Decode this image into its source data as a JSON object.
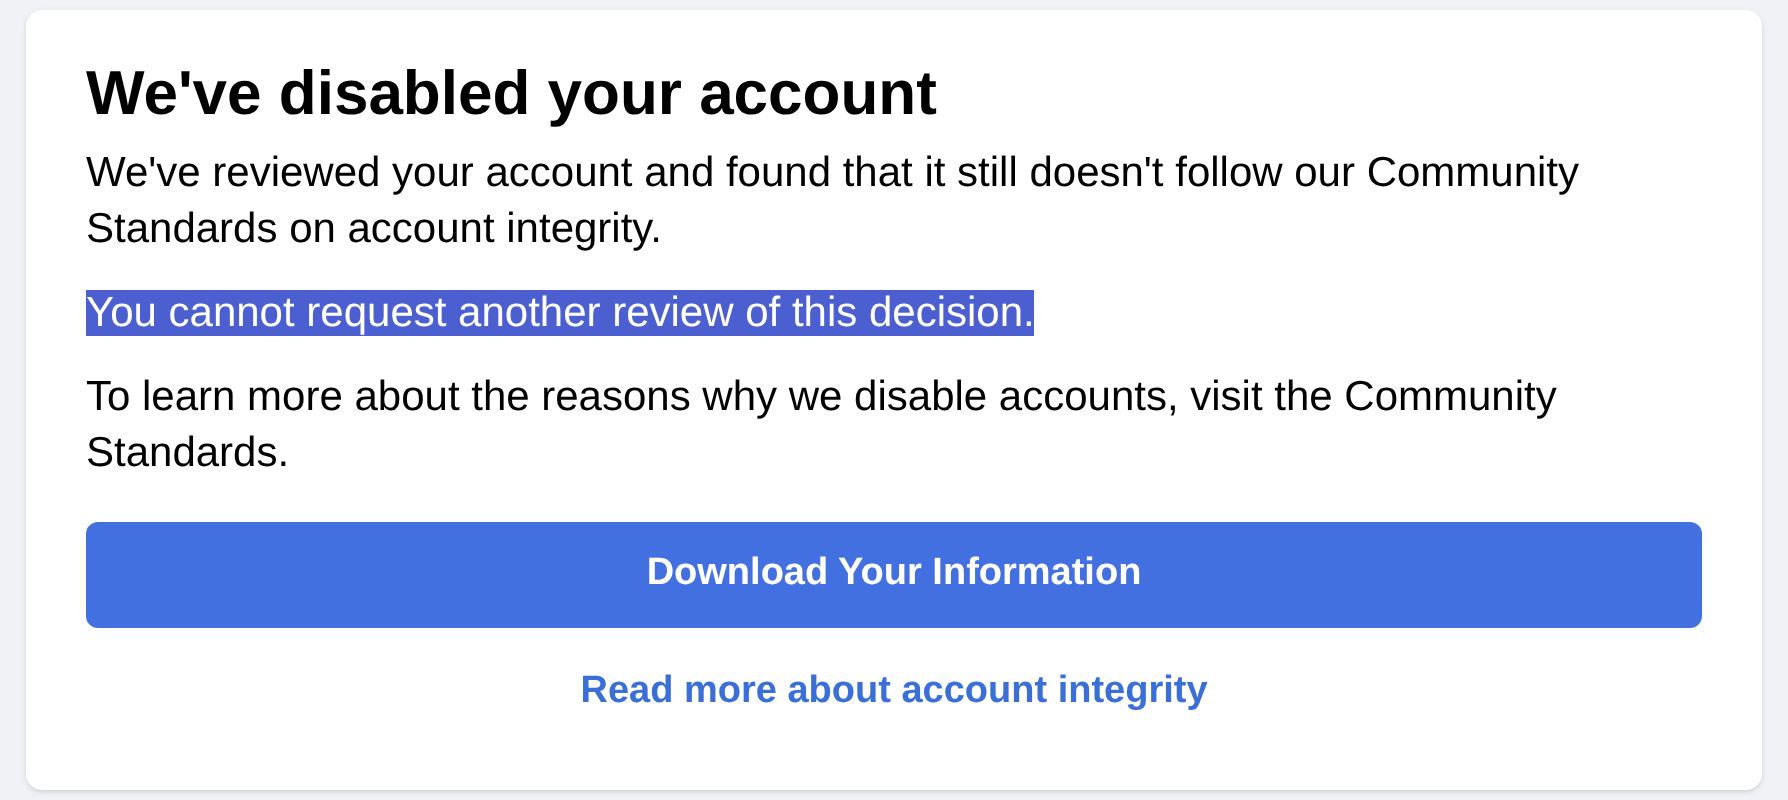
{
  "title": "We've disabled your account",
  "paragraphs": [
    {
      "text": "We've reviewed your account and found that it still doesn't follow our Community Standards on account integrity.",
      "highlighted": false
    },
    {
      "text": "You cannot request another review of this decision.",
      "highlighted": true
    },
    {
      "text": "To learn more about the reasons why we disable accounts, visit the Community Standards.",
      "highlighted": false
    }
  ],
  "button": "Download Your Information",
  "link": "Read more about account integrity"
}
